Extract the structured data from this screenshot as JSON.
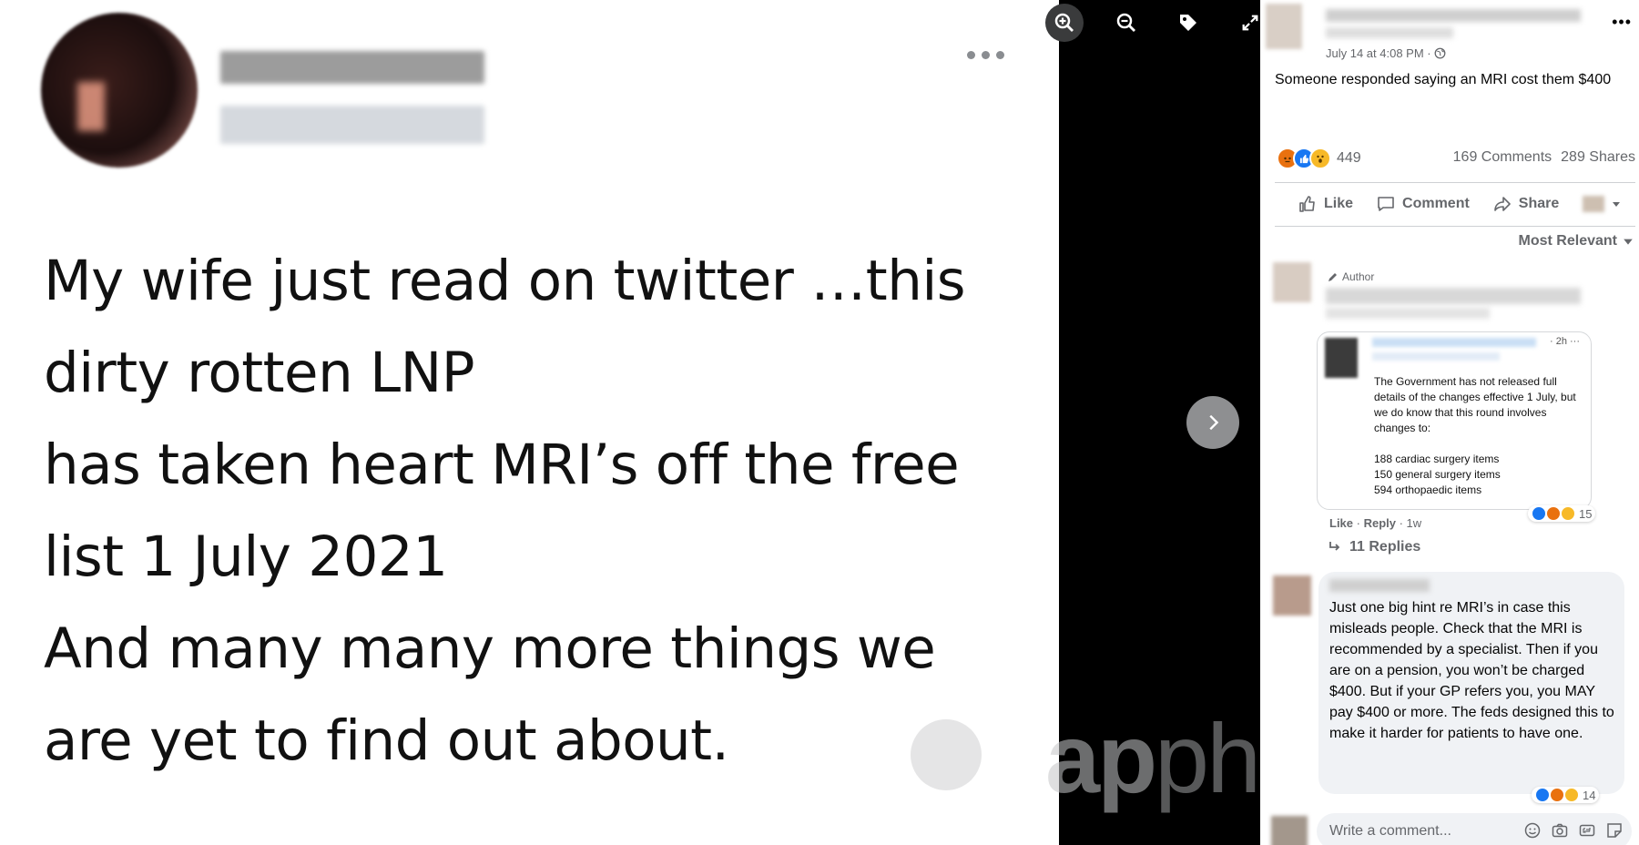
{
  "tweet": {
    "lines": [
      "My wife just read on twitter …this",
      "dirty rotten LNP",
      "has taken heart MRI’s off the free",
      "list 1 July 2021",
      "And many many more things we",
      "are yet to find out about."
    ]
  },
  "photo_viewer": {
    "tools": [
      "zoom-in-icon",
      "zoom-out-icon",
      "tag-icon",
      "fullscreen-icon"
    ],
    "watermark_text": "apphoto"
  },
  "post": {
    "timestamp": "July 14 at 4:08 PM · ",
    "text": "Someone responded saying an MRI cost them $400",
    "reaction_count": "449",
    "comments": "169 Comments",
    "shares": "289 Shares",
    "actions": {
      "like": "Like",
      "comment": "Comment",
      "share": "Share"
    },
    "sort_label": "Most Relevant"
  },
  "comments": [
    {
      "badge": "Author",
      "embed": {
        "time": "· 2h ···",
        "paragraph": "The Government has not released full details of the changes effective 1 July, but we do know that this round involves changes to:",
        "items": [
          "188 cardiac surgery items",
          "150 general surgery items",
          "594 orthopaedic items"
        ]
      },
      "meta": {
        "like": "Like",
        "reply": "Reply",
        "time": "1w"
      },
      "reactions": "15",
      "replies_label": "11 Replies"
    },
    {
      "text": "Just one big hint re MRI’s in case this misleads people. Check that the MRI is recommended by a specialist. Then if you are on a pension, you won’t be charged $400. But if your GP refers you, you MAY pay $400 or more. The feds designed this to make it harder for patients to have one.",
      "reactions": "14"
    }
  ],
  "composer": {
    "placeholder": "Write a comment..."
  },
  "colors": {
    "accent": "#1877f2",
    "muted": "#65676b",
    "angry": "#e9710f",
    "wow": "#f7b928"
  }
}
